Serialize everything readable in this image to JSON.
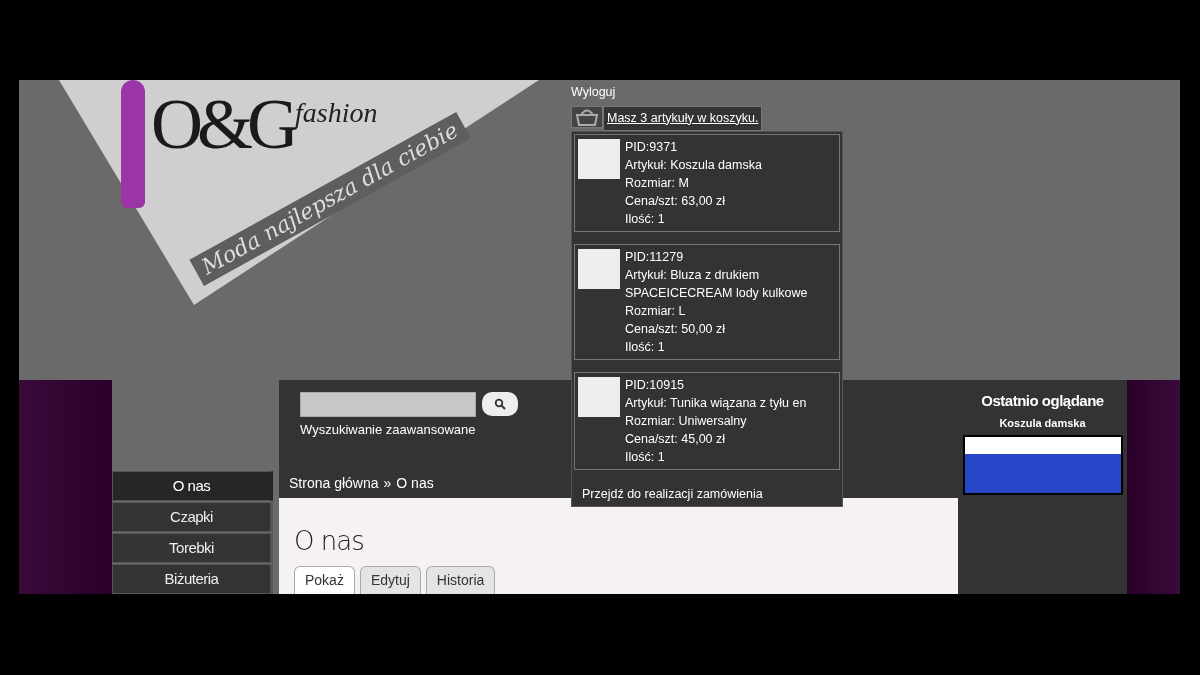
{
  "header": {
    "logo_letters": "O&G",
    "logo_word": "fashion",
    "tagline": "Moda najlepsza dla ciebie"
  },
  "account": {
    "logout": "Wyloguj",
    "cart_summary": "Masz 3 artykuły w koszyku."
  },
  "cart_items": [
    {
      "lines": [
        "PID:9371",
        "Artykuł: Koszula damska",
        "Rozmiar: M",
        "Cena/szt: 63,00 zł",
        "Ilość: 1"
      ]
    },
    {
      "lines": [
        "PID:11279",
        "Artykuł: Bluza z drukiem SPACEICECREAM lody kulkowe",
        "Rozmiar: L",
        "Cena/szt: 50,00 zł",
        "Ilość: 1"
      ]
    },
    {
      "lines": [
        "PID:10915",
        "Artykuł: Tunika wiązana z tyłu en",
        "Rozmiar: Uniwersalny",
        "Cena/szt: 45,00 zł",
        "Ilość: 1"
      ]
    }
  ],
  "cart_checkout": "Przejdź do realizacji zamówienia",
  "search": {
    "advanced_link": "Wyszukiwanie zaawansowane"
  },
  "sidebar": {
    "items": [
      {
        "label": "O nas",
        "selected": true
      },
      {
        "label": "Czapki",
        "selected": false
      },
      {
        "label": "Torebki",
        "selected": false
      },
      {
        "label": "Biżuteria",
        "selected": false
      }
    ]
  },
  "breadcrumb": [
    "Strona główna",
    "»",
    "O nas"
  ],
  "page": {
    "title": "O nas",
    "tabs": [
      {
        "label": "Pokaż",
        "selected": true
      },
      {
        "label": "Edytuj",
        "selected": false
      },
      {
        "label": "Historia",
        "selected": false
      }
    ]
  },
  "recently_viewed": {
    "title": "Ostatnio oglądane",
    "product": "Koszula damska"
  }
}
